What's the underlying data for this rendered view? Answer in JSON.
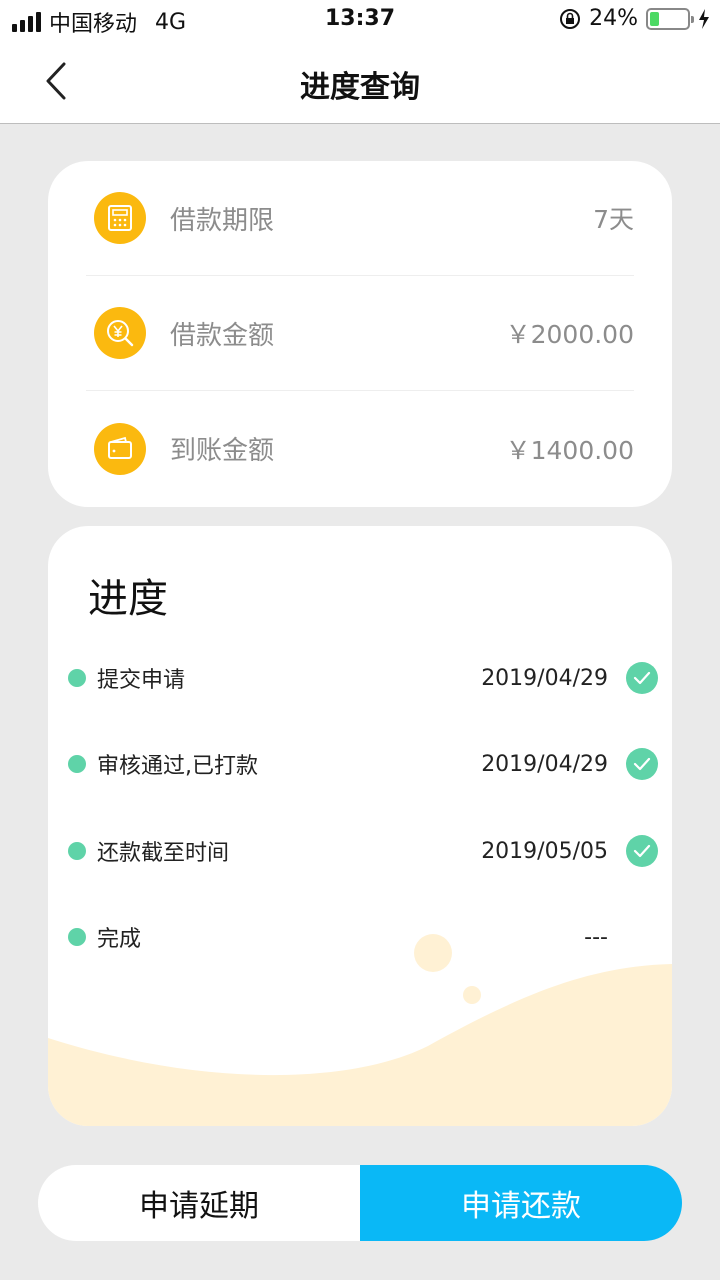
{
  "status_bar": {
    "carrier": "中国移动",
    "network": "4G",
    "time": "13:37",
    "battery": "24%",
    "battery_level": 0.24,
    "icons": [
      "signal-icon",
      "orientation-lock-icon",
      "battery-icon",
      "charging-icon"
    ]
  },
  "nav": {
    "title": "进度查询",
    "back_icon": "chevron-left-icon"
  },
  "loan_info": [
    {
      "label": "借款期限",
      "value": "7天",
      "icon": "calculator-icon"
    },
    {
      "label": "借款金额",
      "value": "￥2000.00",
      "icon": "yen-search-icon"
    },
    {
      "label": "到账金额",
      "value": "￥1400.00",
      "icon": "wallet-icon"
    }
  ],
  "progress": {
    "title": "进度",
    "steps": [
      {
        "label": "提交申请",
        "date": "2019/04/29",
        "done": true
      },
      {
        "label": "审核通过,已打款",
        "date": "2019/04/29",
        "done": true
      },
      {
        "label": "还款截至时间",
        "date": "2019/05/05",
        "done": true
      },
      {
        "label": "完成",
        "date": "---",
        "done": false
      }
    ]
  },
  "actions": {
    "extend_label": "申请延期",
    "repay_label": "申请还款"
  },
  "colors": {
    "accent_yellow": "#fbb90f",
    "accent_green": "#5fd3a8",
    "accent_blue": "#0ab8f6",
    "background": "#eaeaea",
    "wave": "#fff1d4"
  }
}
